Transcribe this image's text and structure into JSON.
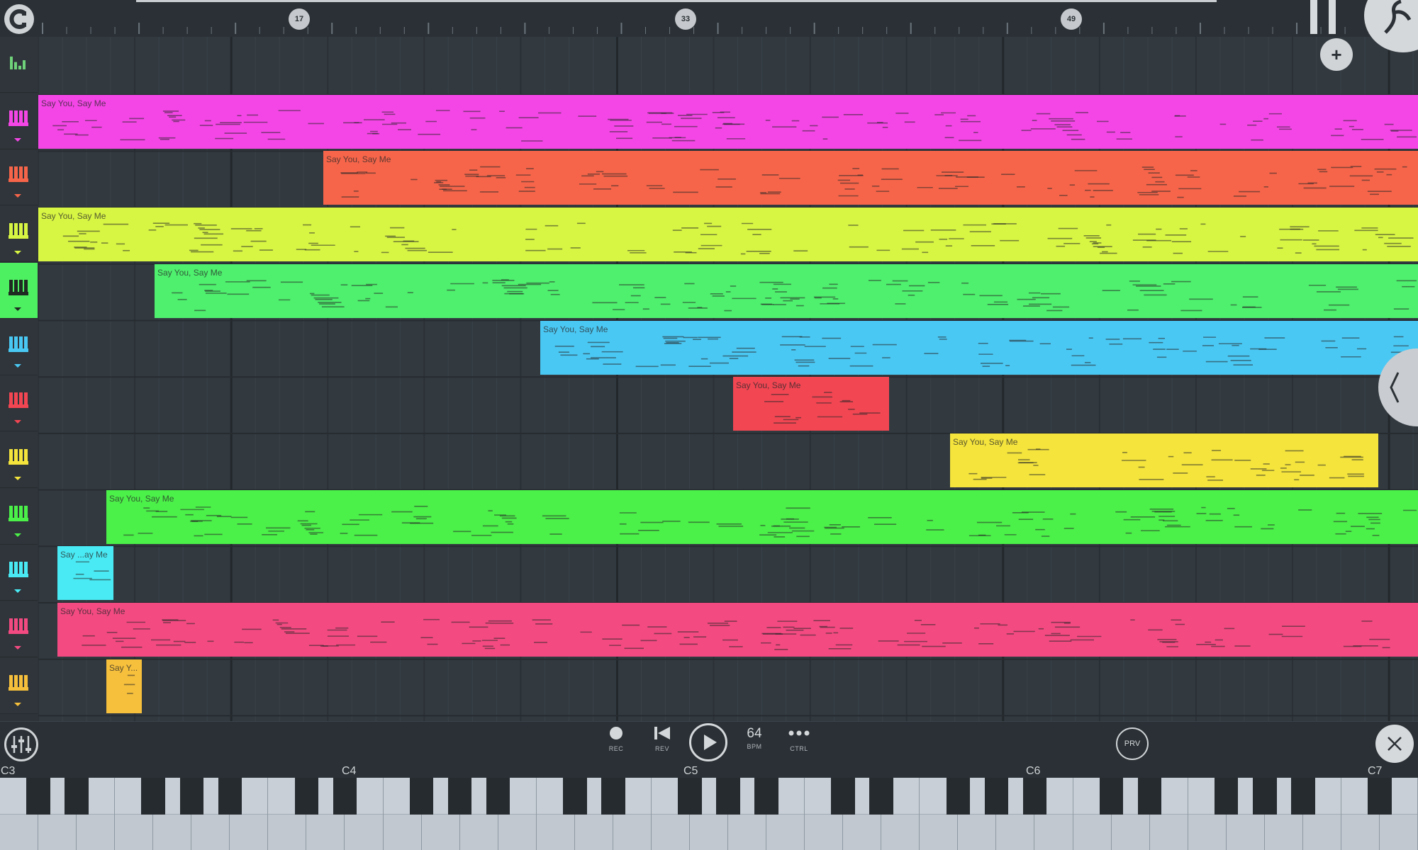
{
  "ruler": {
    "markers": [
      "17",
      "33",
      "49"
    ]
  },
  "clip_name": "Say You, Say Me",
  "tracks": [
    {
      "color": "#6fd27a",
      "icon": "mixer-meter-icon",
      "clips": []
    },
    {
      "color": "#f446e6",
      "icon": "piano-icon",
      "clips": [
        {
          "label": "Say You, Say Me",
          "start": 0,
          "end": 1946
        }
      ]
    },
    {
      "color": "#f6654a",
      "icon": "piano-icon",
      "clips": [
        {
          "label": "Say You, Say Me",
          "start": 402,
          "end": 1946
        }
      ]
    },
    {
      "color": "#d7f543",
      "icon": "piano-icon",
      "clips": [
        {
          "label": "Say You, Say Me",
          "start": 0,
          "end": 1946
        }
      ]
    },
    {
      "color": "#4ef06e",
      "icon": "piano-icon",
      "active": true,
      "clips": [
        {
          "label": "Say You, Say Me",
          "start": 164,
          "end": 1946
        }
      ]
    },
    {
      "color": "#4ac8f4",
      "icon": "piano-icon",
      "clips": [
        {
          "label": "Say You, Say Me",
          "start": 708,
          "end": 1946
        }
      ]
    },
    {
      "color": "#f24653",
      "icon": "piano-icon",
      "clips": [
        {
          "label": "Say You, Say Me",
          "start": 980,
          "end": 1200
        }
      ]
    },
    {
      "color": "#f4e43c",
      "icon": "piano-icon",
      "clips": [
        {
          "label": "Say You, Say Me",
          "start": 1286,
          "end": 1890
        }
      ]
    },
    {
      "color": "#4bf049",
      "icon": "piano-icon",
      "clips": [
        {
          "label": "Say You, Say Me",
          "start": 96,
          "end": 1946
        }
      ]
    },
    {
      "color": "#49eaf4",
      "icon": "piano-icon",
      "clips": [
        {
          "label": "Say ...ay Me",
          "start": 27,
          "end": 106
        }
      ]
    },
    {
      "color": "#f44a82",
      "icon": "piano-icon",
      "clips": [
        {
          "label": "Say You, Say Me",
          "start": 27,
          "end": 1946
        }
      ]
    },
    {
      "color": "#f6bf3c",
      "icon": "piano-icon",
      "clips": [
        {
          "label": "Say Y...",
          "start": 96,
          "end": 146
        }
      ]
    }
  ],
  "transport": {
    "rec": "REC",
    "rev": "REV",
    "bpm_value": "64",
    "bpm": "BPM",
    "ctrl": "CTRL",
    "prv": "PRV"
  },
  "keyboard": {
    "octaves": [
      "C3",
      "C4",
      "C5",
      "C6",
      "C7"
    ]
  },
  "colors": {
    "background": "#2b3136",
    "grid": "#323a40",
    "accent_green": "#4df061"
  }
}
